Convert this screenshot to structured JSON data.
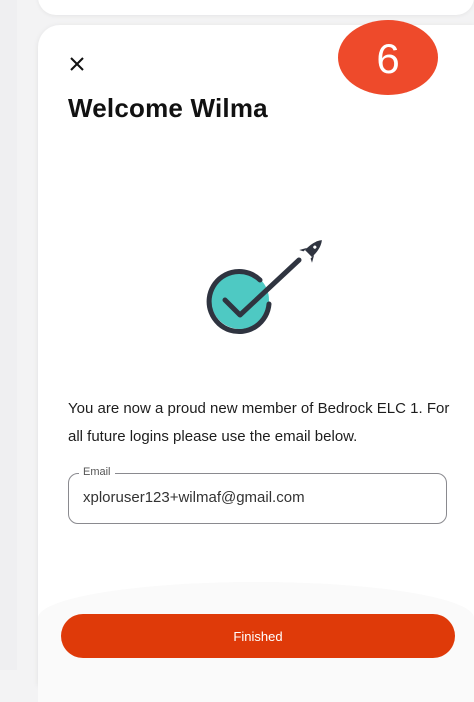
{
  "modal": {
    "title": "Welcome Wilma",
    "step_badge": "6",
    "message": "You are now a proud new member of Bedrock ELC 1. For all future logins please use the email below.",
    "email": {
      "label": "Email",
      "value": "xploruser123+wilmaf@gmail.com"
    },
    "finished_label": "Finished"
  },
  "icons": [
    "close-icon",
    "rocket-check-icon"
  ],
  "colors": {
    "accent": "#df3a09",
    "badge": "#ee4a2b",
    "check_circle": "#4ec9c3",
    "text": "#111111"
  }
}
